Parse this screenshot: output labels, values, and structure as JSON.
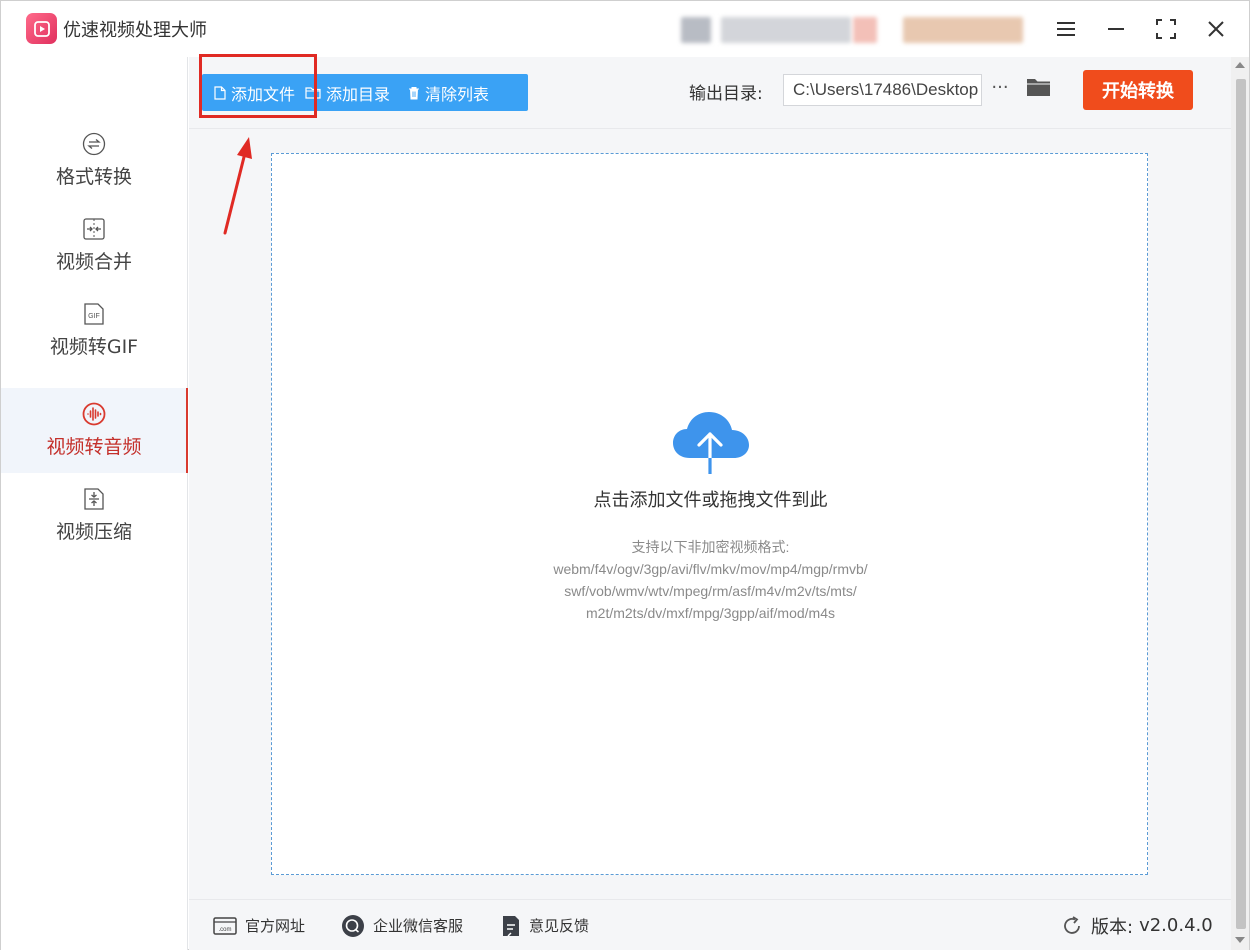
{
  "app": {
    "title": "优速视频处理大师"
  },
  "sidebar": {
    "items": [
      {
        "label": "格式转换",
        "icon": "format-convert-icon"
      },
      {
        "label": "视频合并",
        "icon": "merge-icon"
      },
      {
        "label": "视频转GIF",
        "icon": "gif-icon"
      },
      {
        "label": "视频转音频",
        "icon": "audio-wave-icon",
        "active": true
      },
      {
        "label": "视频压缩",
        "icon": "compress-icon"
      }
    ]
  },
  "toolbar": {
    "add_file": "添加文件",
    "add_folder": "添加目录",
    "clear_list": "清除列表",
    "output_label": "输出目录:",
    "output_path": "C:\\Users\\17486\\Desktop",
    "more": "···",
    "start": "开始转换"
  },
  "dropzone": {
    "title": "点击添加文件或拖拽文件到此",
    "formats_heading": "支持以下非加密视频格式:",
    "formats_line1": "webm/f4v/ogv/3gp/avi/flv/mkv/mov/mp4/mgp/rmvb/",
    "formats_line2": "swf/vob/wmv/wtv/mpeg/rm/asf/m4v/m2v/ts/mts/",
    "formats_line3": "m2t/m2ts/dv/mxf/mpg/3gpp/aif/mod/m4s"
  },
  "footer": {
    "website": "官方网址",
    "wechat": "企业微信客服",
    "feedback": "意见反馈",
    "version_label": "版本:",
    "version": "v2.0.4.0"
  },
  "colors": {
    "accent_blue": "#3aa2f5",
    "start_orange": "#f04c1c",
    "active_red": "#c4302b",
    "annotation_red": "#e02a24"
  }
}
